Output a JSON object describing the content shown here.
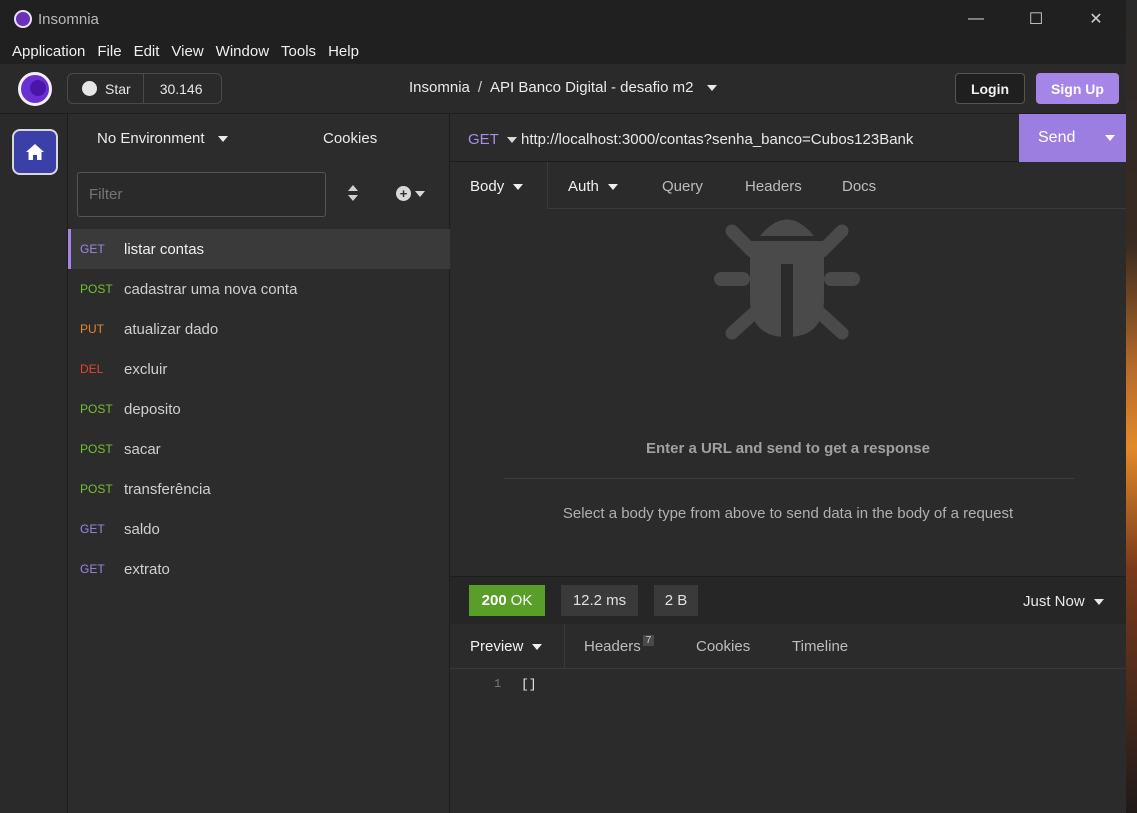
{
  "window": {
    "title": "Insomnia",
    "controls": {
      "minimize": "—",
      "maximize": "☐",
      "close": "✕"
    }
  },
  "menubar": [
    "Application",
    "File",
    "Edit",
    "View",
    "Window",
    "Tools",
    "Help"
  ],
  "header": {
    "star_label": "Star",
    "star_count": "30.146",
    "breadcrumb_root": "Insomnia",
    "breadcrumb_sep": "/",
    "breadcrumb_collection": "API Banco Digital - desafio m2",
    "login_label": "Login",
    "signup_label": "Sign Up"
  },
  "sidebar": {
    "environment": "No Environment",
    "cookies": "Cookies",
    "filter_placeholder": "Filter",
    "requests": [
      {
        "method": "GET",
        "name": "listar contas",
        "color": "#9c86e8",
        "active": true
      },
      {
        "method": "POST",
        "name": "cadastrar uma nova conta",
        "color": "#71c230"
      },
      {
        "method": "PUT",
        "name": "atualizar dado",
        "color": "#e8862a"
      },
      {
        "method": "DEL",
        "name": "excluir",
        "color": "#e2452f"
      },
      {
        "method": "POST",
        "name": "deposito",
        "color": "#71c230"
      },
      {
        "method": "POST",
        "name": "sacar",
        "color": "#71c230"
      },
      {
        "method": "POST",
        "name": "transferência",
        "color": "#71c230"
      },
      {
        "method": "GET",
        "name": "saldo",
        "color": "#9c86e8"
      },
      {
        "method": "GET",
        "name": "extrato",
        "color": "#9c86e8"
      }
    ]
  },
  "request": {
    "method": "GET",
    "url": "http://localhost:3000/contas?senha_banco=Cubos123Bank",
    "send_label": "Send",
    "tabs": {
      "body": "Body",
      "auth": "Auth",
      "query": "Query",
      "headers": "Headers",
      "docs": "Docs"
    },
    "empty_title": "Enter a URL and send to get a response",
    "empty_hint": "Select a body type from above to send data in the body of a request"
  },
  "response": {
    "status_code": "200",
    "status_text": "OK",
    "time": "12.2 ms",
    "size": "2 B",
    "timestamp": "Just Now",
    "tabs": {
      "preview": "Preview",
      "headers": "Headers",
      "headers_count": "7",
      "cookies": "Cookies",
      "timeline": "Timeline"
    },
    "line_number": "1",
    "body": "[]"
  },
  "colors": {
    "accent": "#9c7ee0",
    "status_ok": "#5a9e2a"
  }
}
